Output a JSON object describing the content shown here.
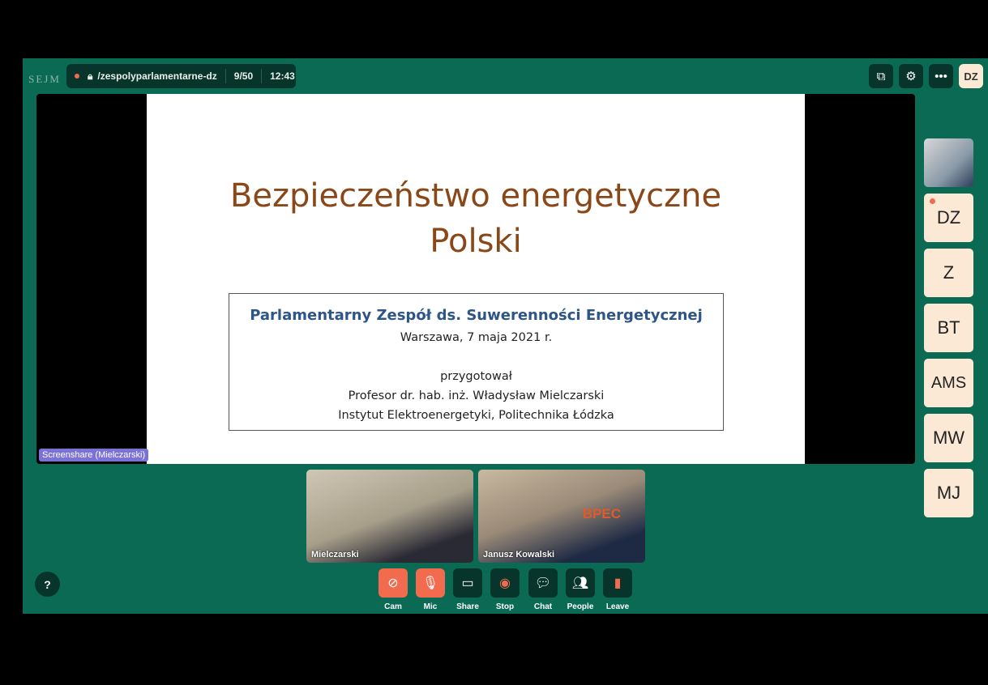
{
  "header": {
    "logo": "SEJM",
    "recording_indicator": "recording",
    "url": "/zespolyparlamentarne-dz",
    "participants": "9/50",
    "time": "12:43",
    "user_initials": "DZ"
  },
  "slide": {
    "title_line1": "Bezpieczeństwo energetyczne",
    "title_line2": "Polski",
    "box_heading": "Parlamentarny Zespół ds. Suwerenności Energetycznej",
    "date": "Warszawa, 7 maja 2021 r.",
    "prepared": "przygotował",
    "author": "Profesor dr. hab. inż. Władysław Mielczarski",
    "institute": "Instytut Elektroenergetyki, Politechnika Łódzka"
  },
  "screenshare_label": "Screenshare (Mielczarski)",
  "sidebar": [
    "DZ",
    "Z",
    "BT",
    "AMS",
    "MW",
    "MJ"
  ],
  "videos": [
    {
      "name": "Mielczarski"
    },
    {
      "name": "Janusz Kowalski",
      "logo": "BPEC"
    }
  ],
  "toolbar": [
    {
      "label": "Cam"
    },
    {
      "label": "Mic"
    },
    {
      "label": "Share"
    },
    {
      "label": "Stop"
    },
    {
      "label": "Chat"
    },
    {
      "label": "People"
    },
    {
      "label": "Leave"
    }
  ],
  "help": "?",
  "colors": {
    "app_bg": "#0a6a54",
    "dark": "#07352b",
    "accent": "#f26b4f",
    "tile": "#fbe9d5"
  }
}
